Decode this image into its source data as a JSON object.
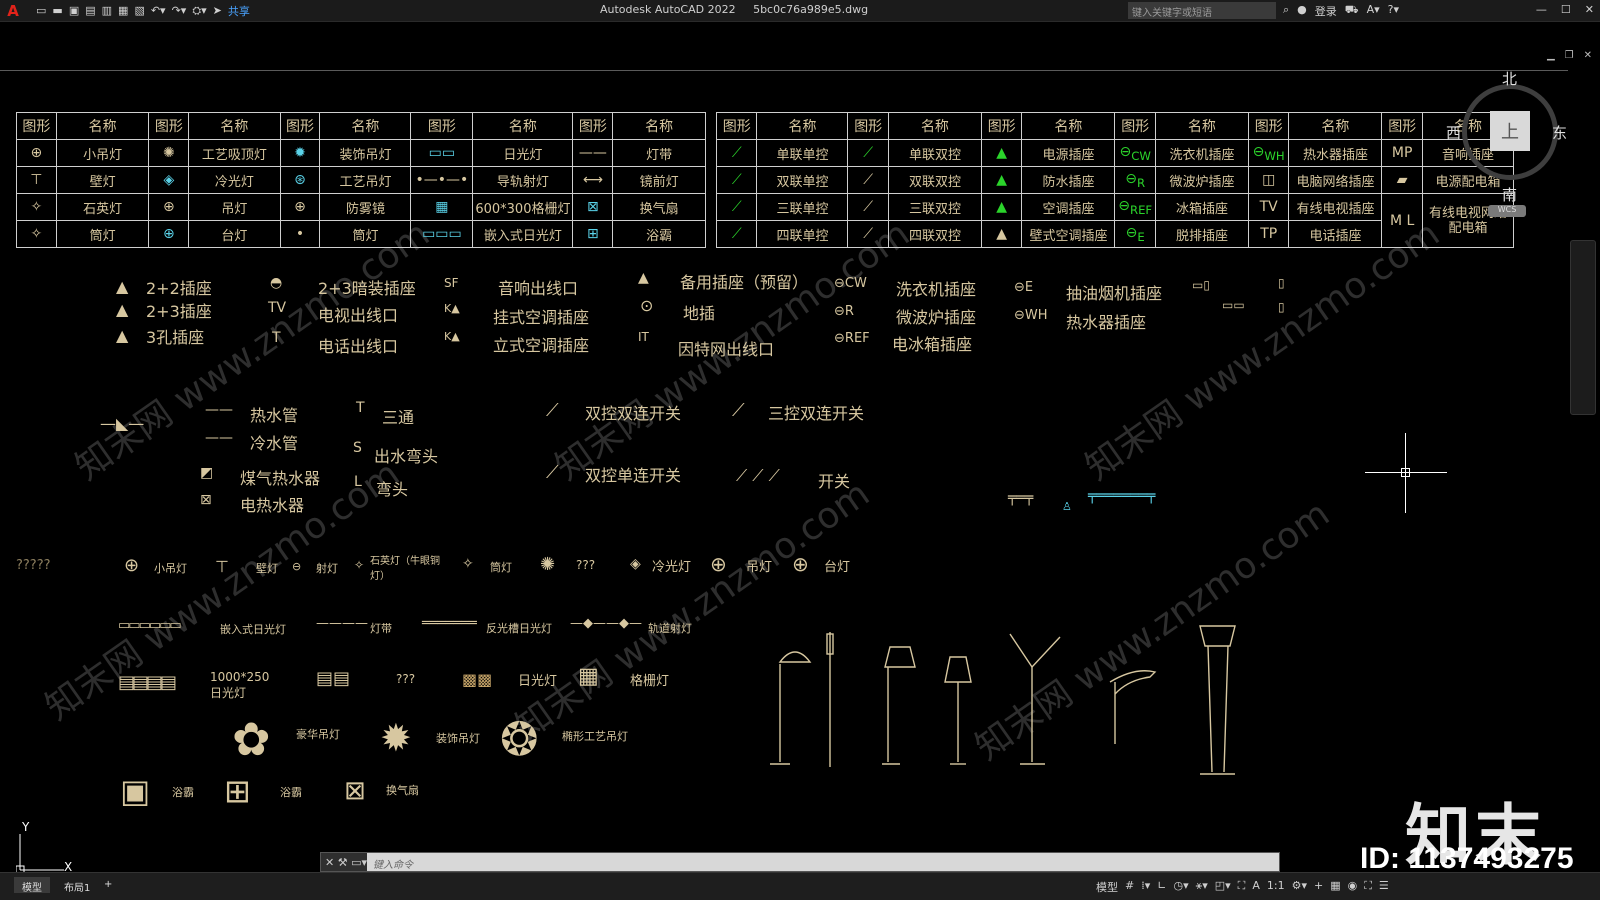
{
  "titlebar": {
    "logo": "A",
    "share_label": "共享",
    "app_title": "Autodesk AutoCAD 2022",
    "file_name": "5bc0c76a989e5.dwg",
    "search_placeholder": "键入关键字或短语",
    "login_label": "登录"
  },
  "viewcube": {
    "north": "北",
    "south": "南",
    "east": "东",
    "west": "西",
    "face": "上",
    "wcs": "WCS"
  },
  "table_left": {
    "headers": [
      "图形",
      "名称",
      "图形",
      "名称",
      "图形",
      "名称",
      "图形",
      "名称",
      "图形",
      "名称"
    ],
    "rows": [
      [
        "小吊灯",
        "工艺吸顶灯",
        "装饰吊灯",
        "日光灯",
        "灯带"
      ],
      [
        "壁灯",
        "冷光灯",
        "工艺吊灯",
        "导轨射灯",
        "镜前灯"
      ],
      [
        "石英灯",
        "吊灯",
        "防雾镜",
        "600*300格栅灯",
        "换气扇"
      ],
      [
        "筒灯",
        "台灯",
        "筒灯",
        "嵌入式日光灯",
        "浴霸"
      ]
    ]
  },
  "table_right": {
    "headers": [
      "图形",
      "名称",
      "图形",
      "名称",
      "图形",
      "名称",
      "图形",
      "名称",
      "图形",
      "名称",
      "图形",
      "名称"
    ],
    "rows": [
      [
        "单联单控",
        "单联双控",
        "电源插座",
        "洗衣机插座",
        "热水器插座",
        "音响插座"
      ],
      [
        "双联单控",
        "双联双控",
        "防水插座",
        "微波炉插座",
        "电脑网络插座",
        "电源配电箱"
      ],
      [
        "三联单控",
        "三联双控",
        "空调插座",
        "冰箱插座",
        "有线电视插座",
        "有线电视网络配电箱"
      ],
      [
        "四联单控",
        "四联双控",
        "壁式空调插座",
        "脱排插座",
        "电话插座",
        ""
      ]
    ],
    "symbol_texts": [
      "CW",
      "R",
      "REF",
      "E",
      "WH",
      "TV",
      "TP",
      "MP",
      "M L"
    ]
  },
  "legend_sockets": {
    "col1": [
      "2+2插座",
      "2+3插座",
      "3孔插座"
    ],
    "col2": [
      "2+3暗装插座",
      "电视出线口",
      "电话出线口"
    ],
    "col3": [
      "音响出线口",
      "挂式空调插座",
      "立式空调插座"
    ],
    "col4": [
      "备用插座（预留）",
      "地插",
      "因特网出线口"
    ],
    "col5": [
      "洗衣机插座",
      "微波炉插座",
      "电冰箱插座"
    ],
    "col6": [
      "抽油烟机插座",
      "热水器插座"
    ],
    "sym_texts": [
      "SF",
      "TV",
      "T",
      "IT",
      "K",
      "CW",
      "R",
      "REF",
      "E",
      "WH"
    ]
  },
  "legend_pipes": {
    "items": [
      "热水管",
      "冷水管",
      "煤气热水器",
      "电热水器"
    ],
    "fittings": [
      "T",
      "三通",
      "S",
      "出水弯头",
      "L",
      "弯头"
    ]
  },
  "legend_switches": {
    "items": [
      "双控双连开关",
      "三控双连开关",
      "双控单连开关",
      "开关"
    ]
  },
  "legend_lights_row": {
    "prefix": "?????",
    "items": [
      "小吊灯",
      "壁灯",
      "射灯",
      "石英灯（牛眼铜灯）",
      "筒灯",
      "???",
      "冷光灯",
      "吊灯",
      "台灯"
    ]
  },
  "legend_lines_row": {
    "items": [
      "嵌入式日光灯",
      "灯带",
      "反光槽日光灯",
      "轨道射灯"
    ]
  },
  "legend_fluor_row": {
    "items": [
      "1000*250日光灯",
      "???",
      "日光灯",
      "格栅灯"
    ]
  },
  "legend_chandeliers": {
    "items": [
      "豪华吊灯",
      "装饰吊灯",
      "椭形工艺吊灯"
    ]
  },
  "legend_bath": {
    "items": [
      "浴霸",
      "浴霸",
      "换气扇"
    ]
  },
  "ucs": {
    "x": "X",
    "y": "Y"
  },
  "watermark": "知末网 www.znzmo.com",
  "brand": "知末",
  "id_label": "ID: 1137493275",
  "command": {
    "placeholder": "键入命令"
  },
  "status": {
    "tabs": [
      "模型",
      "布局1",
      "+"
    ],
    "model_label": "模型",
    "scale": "1:1"
  },
  "colors": {
    "symbol": "#d7c7a0",
    "green": "#1ee01e",
    "cyan": "#5ad2e8",
    "table_border": "#cfcfcf"
  }
}
